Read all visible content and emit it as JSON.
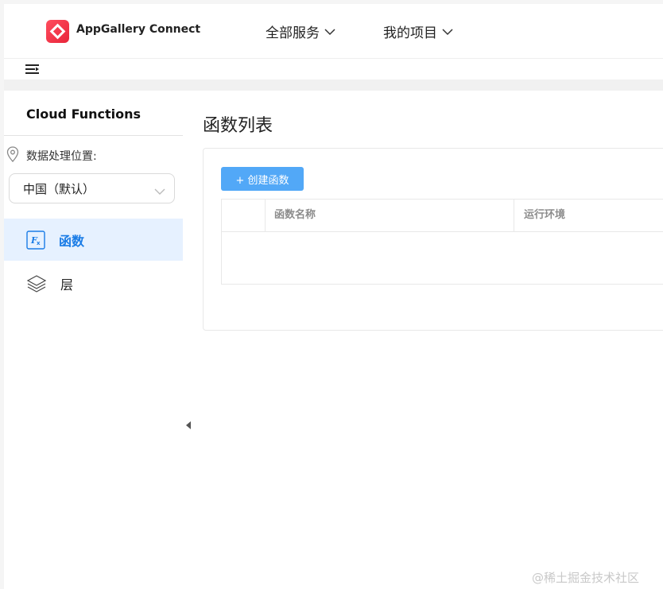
{
  "header": {
    "brand_name": "AppGallery Connect",
    "nav": [
      {
        "label": "全部服务"
      },
      {
        "label": "我的项目"
      }
    ]
  },
  "sidebar": {
    "title": "Cloud Functions",
    "location_label": "数据处理位置:",
    "region_select_value": "中国（默认）",
    "items": [
      {
        "label": "函数",
        "icon": "function-fx-icon",
        "active": true
      },
      {
        "label": "层",
        "icon": "layers-icon",
        "active": false
      }
    ]
  },
  "main": {
    "page_title": "函数列表",
    "create_button_label": "+ 创建函数",
    "table": {
      "columns": [
        "函数名称",
        "运行环境"
      ],
      "rows": []
    }
  },
  "watermark": "@稀土掘金技术社区",
  "colors": {
    "accent": "#1a7ce6",
    "primary_button": "#52a8f7",
    "active_item_bg": "#e6f1ff",
    "logo_red": "#e8253a"
  }
}
